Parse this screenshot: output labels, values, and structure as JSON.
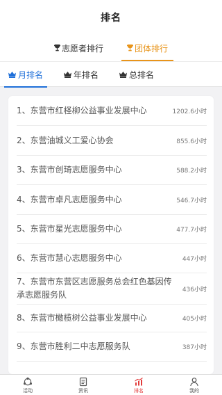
{
  "header": {
    "title": "排名"
  },
  "main_tabs": [
    {
      "label": "志愿者排行",
      "active": false
    },
    {
      "label": "团体排行",
      "active": true
    }
  ],
  "sub_tabs": [
    {
      "label": "月排名",
      "active": true
    },
    {
      "label": "年排名",
      "active": false
    },
    {
      "label": "总排名",
      "active": false
    }
  ],
  "ranking": [
    {
      "name": "1、东营市红柽柳公益事业发展中心",
      "hours": "1202.6小时"
    },
    {
      "name": "2、东营油城义工爱心协会",
      "hours": "855.6小时"
    },
    {
      "name": "3、东营市创琦志愿服务中心",
      "hours": "588.2小时"
    },
    {
      "name": "4、东营市卓凡志愿服务中心",
      "hours": "546.7小时"
    },
    {
      "name": "5、东营市星光志愿服务中心",
      "hours": "477.7小时"
    },
    {
      "name": "6、东营市慧心志愿服务中心",
      "hours": "447小时"
    },
    {
      "name": "7、东营市东营区志愿服务总会红色基因传承志愿服务队",
      "hours": "436小时"
    },
    {
      "name": "8、东营市橄榄树公益事业发展中心",
      "hours": "405小时"
    },
    {
      "name": "9、东营市胜利二中志愿服务队",
      "hours": "387小时"
    }
  ],
  "bottom_nav": [
    {
      "label": "活动",
      "icon": "activity-icon",
      "active": false
    },
    {
      "label": "资讯",
      "icon": "news-icon",
      "active": false
    },
    {
      "label": "排名",
      "icon": "ranking-chart-icon",
      "active": true
    },
    {
      "label": "我的",
      "icon": "profile-icon",
      "active": false
    }
  ],
  "colors": {
    "accent_orange": "#e8941a",
    "accent_blue": "#1e6fd9",
    "accent_red": "#e23b3b"
  }
}
